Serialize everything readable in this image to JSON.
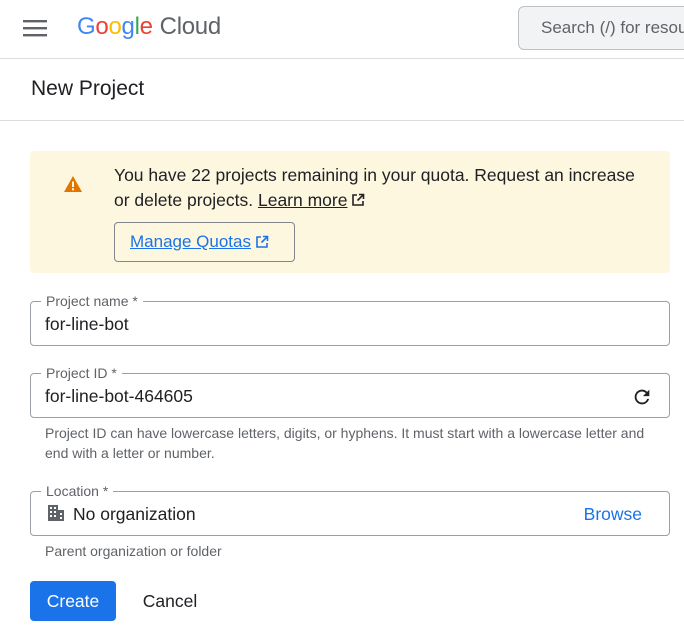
{
  "topbar": {
    "logo_letters": [
      "G",
      "o",
      "o",
      "g",
      "l",
      "e"
    ],
    "logo_product": "Cloud",
    "search_placeholder": "Search (/) for resources"
  },
  "page": {
    "title": "New Project"
  },
  "quota_warning": {
    "text": "You have 22 projects remaining in your quota. Request an increase or delete projects.",
    "learn_more": "Learn more",
    "manage_quotas": "Manage Quotas"
  },
  "form": {
    "project_name": {
      "label": "Project name *",
      "value": "for-line-bot"
    },
    "project_id": {
      "label": "Project ID *",
      "value": "for-line-bot-464605",
      "help": "Project ID can have lowercase letters, digits, or hyphens. It must start with a lowercase letter and end with a letter or number."
    },
    "location": {
      "label": "Location *",
      "value": "No organization",
      "browse": "Browse",
      "help": "Parent organization or folder"
    }
  },
  "actions": {
    "create": "Create",
    "cancel": "Cancel"
  },
  "colors": {
    "primary": "#1a73e8",
    "warning_bg": "#fef7e0",
    "warning_icon": "#e37400"
  },
  "icons": [
    "menu-icon",
    "warning-icon",
    "external-link-icon",
    "refresh-icon",
    "organization-icon"
  ]
}
